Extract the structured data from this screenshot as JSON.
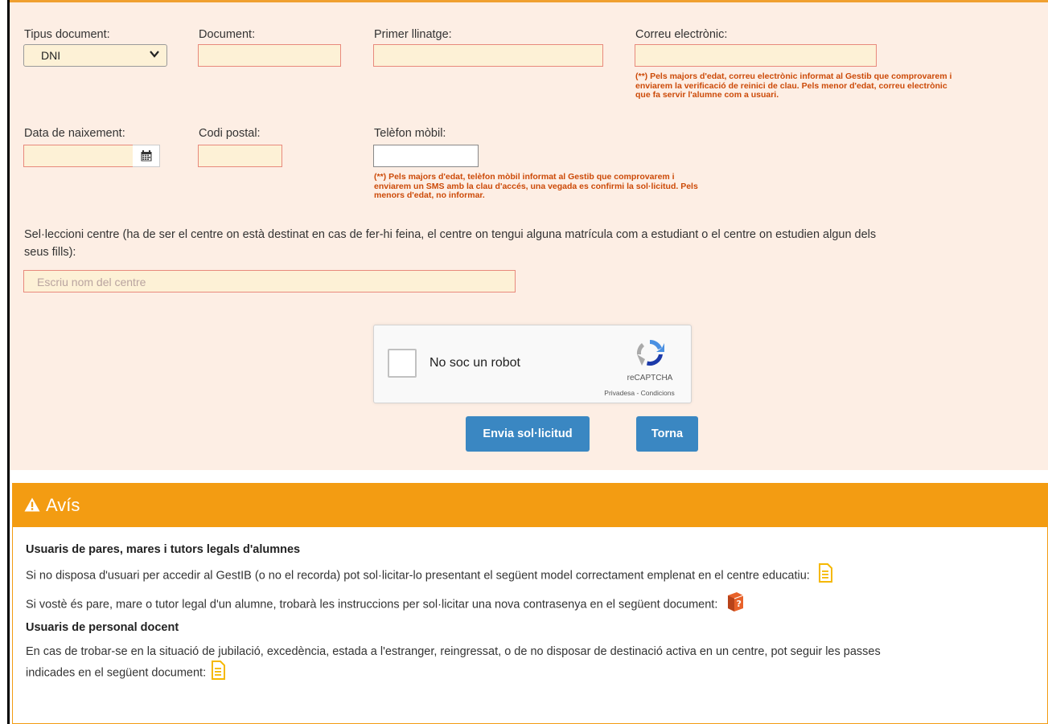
{
  "form": {
    "tipus_label": "Tipus document:",
    "tipus_value": "DNI",
    "document_label": "Document:",
    "llinatge_label": "Primer llinatge:",
    "correu_label": "Correu electrònic:",
    "correu_note_1": "(**) Pels majors d'edat, correu electrònic informat al Gestib que comprovarem i",
    "correu_note_2": "enviarem la verificació de reinici de clau. Pels menor d'edat, correu electrònic",
    "correu_note_3": "que fa servir l'alumne com a usuari.",
    "naixement_label": "Data de naixement:",
    "postal_label": "Codi postal:",
    "telefon_label": "Telèfon mòbil:",
    "telefon_note_1": "(**) Pels majors d'edat, telèfon mòbil informat al Gestib que comprovarem i",
    "telefon_note_2": "enviarem un SMS amb la clau d'accés, una vegada es confirmi la sol·licitud. Pels",
    "telefon_note_3": "menors d'edat, no informar.",
    "centre_label_1": "Sel·leccioni centre (ha de ser el centre on està destinat en cas de fer-hi feina, el centre on tengui alguna matrícula com a estudiant o el centre on estudien algun dels",
    "centre_label_2": "seus fills):",
    "centre_placeholder": "Escriu nom del centre"
  },
  "captcha": {
    "label": "No soc un robot",
    "brand": "reCAPTCHA",
    "links": "Privadesa - Condicions"
  },
  "buttons": {
    "submit": "Envia sol·licitud",
    "back": "Torna"
  },
  "colors": {
    "primary_button": "#3a87c2",
    "warning": "#f39c12",
    "note_text": "#cc4a08",
    "panel_bg": "#fdeee4"
  },
  "avis": {
    "title": "Avís",
    "icon": "warning-icon",
    "section1_title": "Usuaris de pares, mares i tutors legals d'alumnes",
    "section1_p1": "Si no disposa d'usuari per accedir al GestIB (o no el recorda) pot sol·licitar-lo presentant el següent model correctament emplenat en el centre educatiu:",
    "section1_p2": "Si vostè és pare, mare o tutor legal d'un alumne, trobarà les instruccions per sol·licitar una nova contrasenya en el següent document:",
    "section2_title": "Usuaris de personal docent",
    "section2_p1": "En cas de trobar-se en la situació de jubilació, excedència, estada a l'estranger, reingressat, o de no disposar de destinació activa en un centre, pot seguir les passes",
    "section2_p1b": "indicades en el següent document:"
  }
}
